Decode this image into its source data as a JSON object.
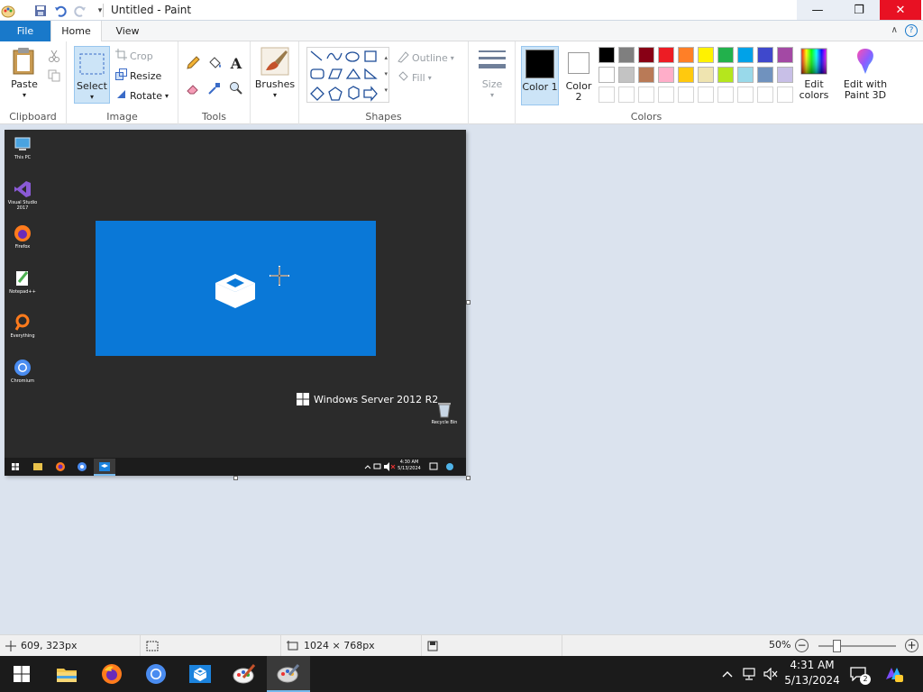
{
  "window": {
    "title": "Untitled - Paint",
    "minimize": "—",
    "maximize": "❐",
    "close": "✕"
  },
  "tabs": {
    "file": "File",
    "home": "Home",
    "view": "View"
  },
  "ribbon": {
    "clipboard": {
      "label": "Clipboard",
      "paste": "Paste"
    },
    "image": {
      "label": "Image",
      "select": "Select",
      "crop": "Crop",
      "resize": "Resize",
      "rotate": "Rotate"
    },
    "tools": {
      "label": "Tools"
    },
    "brushes": {
      "label": "Brushes"
    },
    "shapes": {
      "label": "Shapes",
      "outline": "Outline",
      "fill": "Fill"
    },
    "size": {
      "label": "Size"
    },
    "colors": {
      "label": "Colors",
      "color1": "Color 1",
      "color2": "Color 2",
      "edit_colors": "Edit colors",
      "edit_3d": "Edit with Paint 3D",
      "color1_value": "#000000",
      "color2_value": "#ffffff",
      "palette_row1": [
        "#000000",
        "#7f7f7f",
        "#880015",
        "#ed1c24",
        "#ff7f27",
        "#fff200",
        "#22b14c",
        "#00a2e8",
        "#3f48cc",
        "#a349a4"
      ],
      "palette_row2": [
        "#ffffff",
        "#c3c3c3",
        "#b97a57",
        "#ffaec9",
        "#ffc90e",
        "#efe4b0",
        "#b5e61d",
        "#99d9ea",
        "#7092be",
        "#c8bfe7"
      ]
    }
  },
  "image": {
    "desktop_icons": [
      {
        "label": "This PC",
        "icon": "this-pc-icon"
      },
      {
        "label": "Visual Studio 2017",
        "icon": "visual-studio-icon"
      },
      {
        "label": "Firefox",
        "icon": "firefox-icon"
      },
      {
        "label": "Notepad++",
        "icon": "notepadpp-icon"
      },
      {
        "label": "Everything",
        "icon": "everything-icon"
      },
      {
        "label": "Chromium",
        "icon": "chromium-icon"
      }
    ],
    "brand": "Windows Server 2012 R2",
    "recycle_bin": "Recycle Bin",
    "clock_time": "4:30 AM",
    "clock_date": "5/13/2024"
  },
  "status": {
    "cursor_pos": "609, 323px",
    "image_size": "1024 × 768px",
    "zoom": "50%"
  },
  "taskbar": {
    "time": "4:31 AM",
    "date": "5/13/2024",
    "notifications": "2"
  }
}
